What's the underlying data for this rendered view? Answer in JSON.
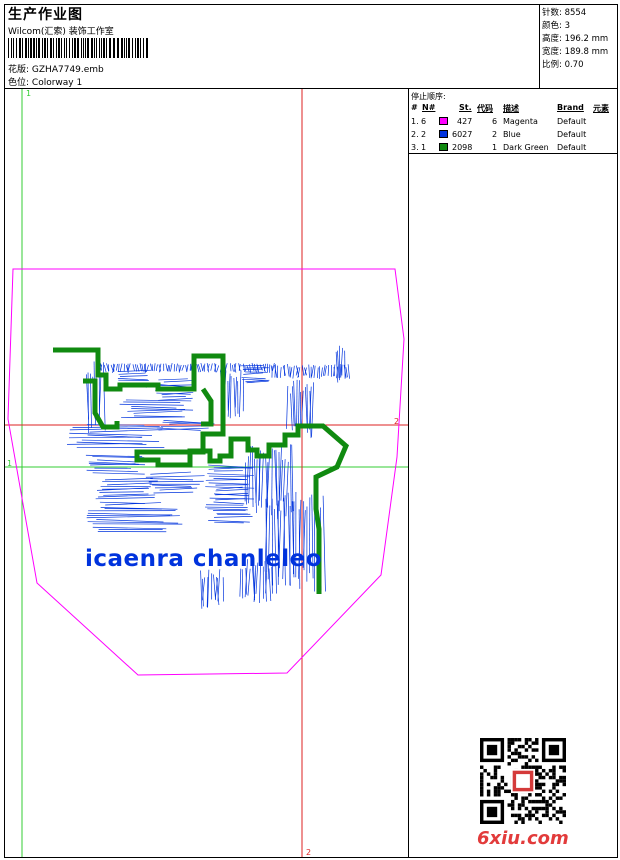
{
  "header": {
    "title": "生产作业图",
    "company": "Wilcom(汇索) 装饰工作室",
    "design_label": "花版:",
    "design_value": "GZHA7749.emb",
    "color_label": "色位:",
    "color_value": "Colorway 1"
  },
  "stats": {
    "stitches": "针数: 8554",
    "colors": "颜色: 3",
    "height": "高度: 196.2 mm",
    "width": "宽度: 189.8 mm",
    "scale": "比例: 0.70"
  },
  "stop_sequence": {
    "title": "停止顺序:",
    "headers": [
      "#",
      "N#",
      "St.",
      "代码",
      "描述",
      "Brand",
      "元素"
    ],
    "rows": [
      {
        "idx": "1.",
        "n": "6",
        "color": "#ff00ff",
        "st": "427",
        "code": "6",
        "desc": "Magenta",
        "brand": "Default"
      },
      {
        "idx": "2.",
        "n": "2",
        "color": "#0033dd",
        "st": "6027",
        "code": "2",
        "desc": "Blue",
        "brand": "Default"
      },
      {
        "idx": "3.",
        "n": "1",
        "color": "#108a10",
        "st": "2098",
        "code": "1",
        "desc": "Dark Green",
        "brand": "Default"
      }
    ]
  },
  "design": {
    "embroidered_text": "icaenra chanleleo",
    "axis_labels": {
      "v1": "1",
      "h1": "1",
      "v2": "2",
      "h2": "2"
    }
  },
  "footer": {
    "logo": "6xiu.com"
  },
  "colors": {
    "magenta": "#ff00ff",
    "blue": "#0033dd",
    "green": "#108a10",
    "guide_green": "#33cc33",
    "guide_red": "#dd2222"
  }
}
